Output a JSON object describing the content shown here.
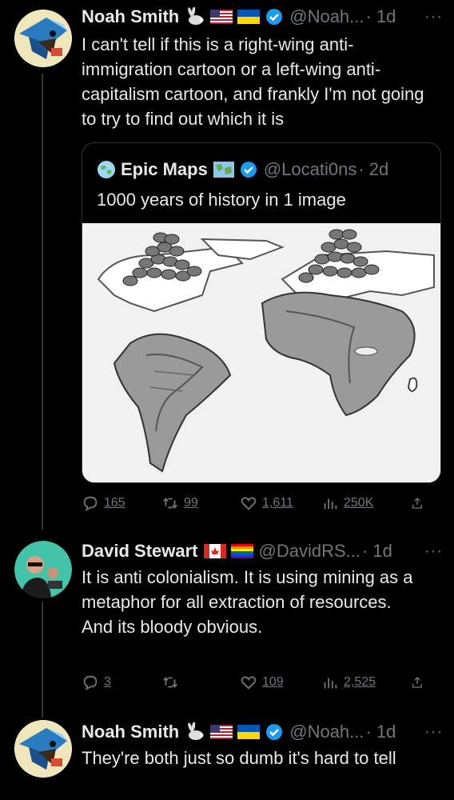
{
  "tweets": [
    {
      "name": "Noah Smith",
      "handle": "@Noah...",
      "time": "· 1d",
      "text": "I can't tell if this is a right-wing anti-immigration cartoon or a left-wing anti-capitalism cartoon, and frankly I'm not going to try to find out which it is"
    },
    {
      "name": "David Stewart",
      "handle": "@DavidRS...",
      "time": "· 1d",
      "text_lines": [
        "It is anti colonialism. It is using mining as a metaphor for all extraction of resources.",
        "And its bloody obvious."
      ]
    },
    {
      "name": "Noah Smith",
      "handle": "@Noah...",
      "time": "· 1d",
      "text": "They're both just so dumb it's hard to tell"
    }
  ],
  "quote": {
    "name": "Epic Maps",
    "handle": "@Locati0ns",
    "time": "· 2d",
    "text": "1000 years of history in 1 image"
  },
  "stats": [
    {
      "replies": "165",
      "retweets": "99",
      "likes": "1,611",
      "views": "250K"
    },
    {
      "replies": "3",
      "retweets": "",
      "likes": "109",
      "views": "2,525"
    }
  ],
  "more_label": "···",
  "colors": {
    "background": "#000000",
    "text": "#e7e9ea",
    "muted": "#71767b",
    "verified": "#1d9bf0",
    "border": "#2f3336"
  },
  "icons": [
    "rabbit-icon",
    "us-flag-icon",
    "ukraine-flag-icon",
    "canada-flag-icon",
    "rainbow-flag-icon",
    "verified-badge-icon",
    "reply-icon",
    "retweet-icon",
    "like-icon",
    "views-icon",
    "share-icon",
    "globe-icon",
    "map-icon"
  ]
}
